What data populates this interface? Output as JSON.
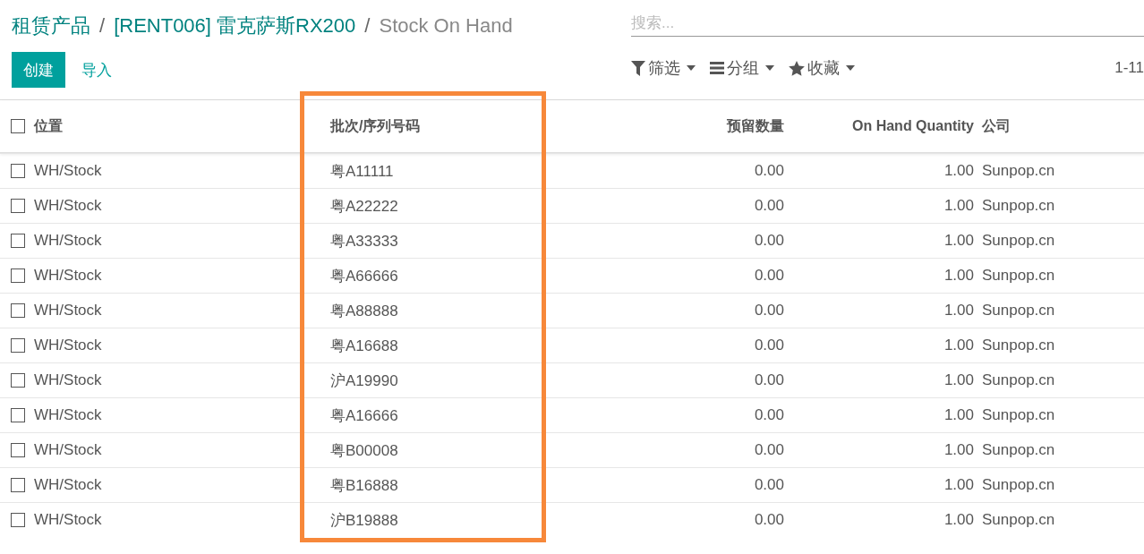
{
  "breadcrumb": [
    {
      "label": "租赁产品",
      "kind": "link"
    },
    {
      "label": "/",
      "kind": "separator"
    },
    {
      "label": "[RENT006] 雷克萨斯RX200",
      "kind": "link"
    },
    {
      "label": "/",
      "kind": "separator"
    },
    {
      "label": "Stock On Hand",
      "kind": "current"
    }
  ],
  "search": {
    "placeholder": "搜索..."
  },
  "buttons": [
    {
      "label": "创建",
      "kind": "primary"
    },
    {
      "label": "导入",
      "kind": "link"
    }
  ],
  "options": [
    {
      "label": "筛选",
      "kind": "filter"
    },
    {
      "label": "分组",
      "kind": "group"
    },
    {
      "label": "收藏",
      "kind": "favorite"
    }
  ],
  "pager": "1-11",
  "table": {
    "select_all": {
      "checked": false
    },
    "columns": [
      {
        "label": "位置",
        "kind": "text",
        "highlighted": false
      },
      {
        "label": "批次/序列号码",
        "kind": "text",
        "highlighted": true
      },
      {
        "label": "预留数量",
        "kind": "number",
        "highlighted": false
      },
      {
        "label": "On Hand Quantity",
        "kind": "number",
        "highlighted": false
      },
      {
        "label": "公司",
        "kind": "text",
        "highlighted": false
      }
    ],
    "rows": [
      {
        "checked": false,
        "cells": [
          "WH/Stock",
          "粤A11111",
          "0.00",
          "1.00",
          "Sunpop.cn"
        ]
      },
      {
        "checked": false,
        "cells": [
          "WH/Stock",
          "粤A22222",
          "0.00",
          "1.00",
          "Sunpop.cn"
        ]
      },
      {
        "checked": false,
        "cells": [
          "WH/Stock",
          "粤A33333",
          "0.00",
          "1.00",
          "Sunpop.cn"
        ]
      },
      {
        "checked": false,
        "cells": [
          "WH/Stock",
          "粤A66666",
          "0.00",
          "1.00",
          "Sunpop.cn"
        ]
      },
      {
        "checked": false,
        "cells": [
          "WH/Stock",
          "粤A88888",
          "0.00",
          "1.00",
          "Sunpop.cn"
        ]
      },
      {
        "checked": false,
        "cells": [
          "WH/Stock",
          "粤A16688",
          "0.00",
          "1.00",
          "Sunpop.cn"
        ]
      },
      {
        "checked": false,
        "cells": [
          "WH/Stock",
          "沪A19990",
          "0.00",
          "1.00",
          "Sunpop.cn"
        ]
      },
      {
        "checked": false,
        "cells": [
          "WH/Stock",
          "粤A16666",
          "0.00",
          "1.00",
          "Sunpop.cn"
        ]
      },
      {
        "checked": false,
        "cells": [
          "WH/Stock",
          "粤B00008",
          "0.00",
          "1.00",
          "Sunpop.cn"
        ]
      },
      {
        "checked": false,
        "cells": [
          "WH/Stock",
          "粤B16888",
          "0.00",
          "1.00",
          "Sunpop.cn"
        ]
      },
      {
        "checked": false,
        "cells": [
          "WH/Stock",
          "沪B19888",
          "0.00",
          "1.00",
          "Sunpop.cn"
        ]
      }
    ]
  }
}
